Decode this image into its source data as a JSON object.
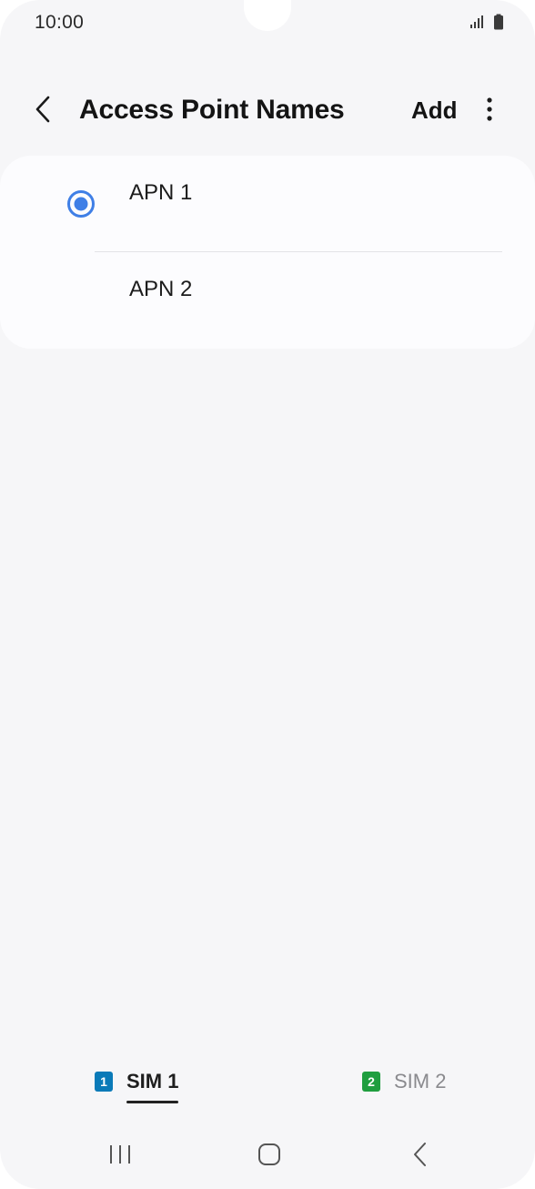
{
  "status": {
    "time": "10:00",
    "signal_icon": "signal-icon",
    "battery_icon": "battery-icon"
  },
  "header": {
    "back_icon": "chevron-left-icon",
    "title": "Access Point Names",
    "add_label": "Add",
    "more_icon": "more-vertical-icon"
  },
  "apns": [
    {
      "label": "APN 1",
      "selected": true
    },
    {
      "label": "APN 2",
      "selected": false
    }
  ],
  "sim_tabs": [
    {
      "badge": "1",
      "label": "SIM 1",
      "active": true,
      "color": "#0a7ab8"
    },
    {
      "badge": "2",
      "label": "SIM 2",
      "active": false,
      "color": "#1f9e3f"
    }
  ],
  "nav": {
    "recents_icon": "recents-icon",
    "home_icon": "home-icon",
    "back_icon": "back-icon"
  },
  "colors": {
    "accent": "#3f7fe6",
    "background": "#f6f6f8",
    "card": "#fcfcfe"
  }
}
